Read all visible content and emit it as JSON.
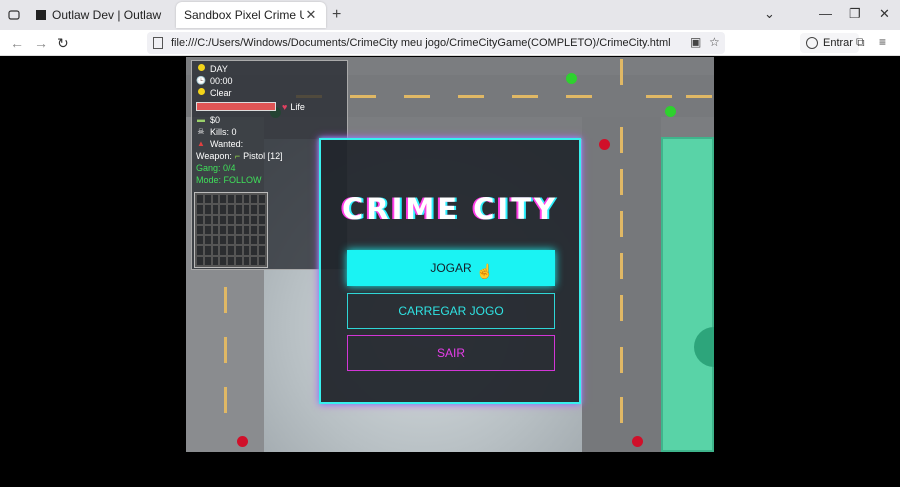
{
  "browser": {
    "tabs": [
      {
        "title": "Outlaw Dev | Outlaw Game Studi",
        "active": false
      },
      {
        "title": "Sandbox Pixel Crime Upgrade",
        "active": true
      }
    ],
    "url": "file:///C:/Users/Windows/Documents/CrimeCity meu jogo/CrimeCityGame(COMPLETO)/CrimeCity.html",
    "signin_label": "Entrar"
  },
  "hud": {
    "time_of_day": "DAY",
    "clock": "00:00",
    "weather": "Clear",
    "life_label": "Life",
    "money": "$0",
    "kills": "Kills: 0",
    "wanted": "Wanted:",
    "weapon_label": "Weapon:",
    "weapon": "Pistol [12]",
    "gang": "Gang: 0/4",
    "mode": "Mode: FOLLOW",
    "life_fraction": 1.0
  },
  "menu": {
    "title": "CRIME CITY",
    "play": "JOGAR",
    "load": "CARREGAR JOGO",
    "quit": "SAIR"
  },
  "colors": {
    "accent_cyan": "#1af3f3",
    "accent_magenta": "#e63ee9",
    "grass": "#59d3a7"
  }
}
